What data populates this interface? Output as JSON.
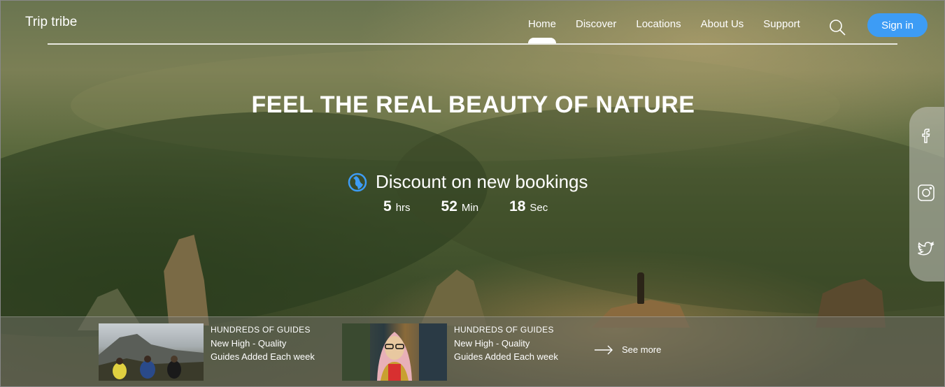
{
  "header": {
    "logo": "Trip tribe",
    "nav": [
      "Home",
      "Discover",
      "Locations",
      "About Us",
      "Support"
    ],
    "active_nav": "Home",
    "search_icon": "search-icon",
    "signin_label": "Sign in"
  },
  "hero": {
    "title": "FEEL THE REAL BEAUTY OF NATURE",
    "discount_text": "Discount on new bookings",
    "discount_icon": "globe-icon",
    "timer": {
      "hours": "5",
      "hours_unit": "hrs",
      "minutes": "52",
      "minutes_unit": "Min",
      "seconds": "18",
      "seconds_unit": "Sec"
    }
  },
  "social": [
    "facebook-icon",
    "instagram-icon",
    "twitter-icon"
  ],
  "cards": [
    {
      "kicker": "HUNDREDS OF GUIDES",
      "text": "New High - Quality Guides Added Each week"
    },
    {
      "kicker": "HUNDREDS OF GUIDES",
      "text": "New High - Quality Guides Added Each week"
    }
  ],
  "see_more_label": "See more",
  "colors": {
    "accent": "#3d9cf5",
    "text": "#ffffff"
  }
}
